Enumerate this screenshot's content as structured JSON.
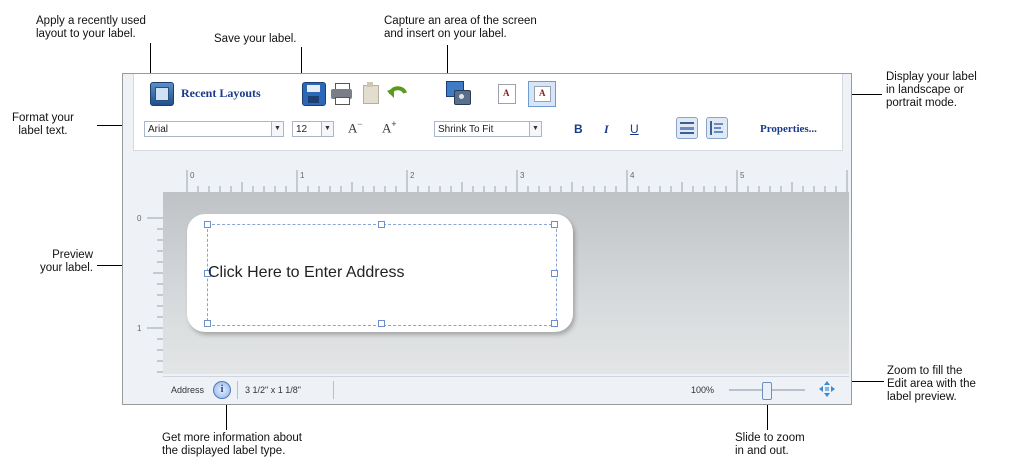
{
  "callouts": {
    "apply_layout": "Apply a recently used\nlayout to your label.",
    "save": "Save your label.",
    "capture": "Capture an area of the screen\nand insert on your label.",
    "orientation": "Display your label\nin landscape or\nportrait mode.",
    "format_text": "Format your\nlabel text.",
    "preview": "Preview\nyour label.",
    "zoom_fill": "Zoom to fill the\nEdit area with the\nlabel preview.",
    "more_info": "Get more information about\nthe displayed label type.",
    "slide_zoom": "Slide to zoom\nin and out."
  },
  "toolbar": {
    "recent_layouts_label": "Recent Layouts",
    "font": "Arial",
    "font_size": "12",
    "fit_mode": "Shrink To Fit",
    "bold": "B",
    "italic": "I",
    "underline": "U",
    "properties_label": "Properties..."
  },
  "ruler": {
    "h_marks": [
      "0",
      "1",
      "2",
      "3",
      "4",
      "5"
    ],
    "v_marks": [
      "0",
      "1"
    ]
  },
  "label": {
    "placeholder": "Click Here to Enter Address"
  },
  "status": {
    "label_type": "Address",
    "label_size": "3 1/2\" x 1 1/8\"",
    "zoom": "100%",
    "zoom_fraction": 0.5
  }
}
